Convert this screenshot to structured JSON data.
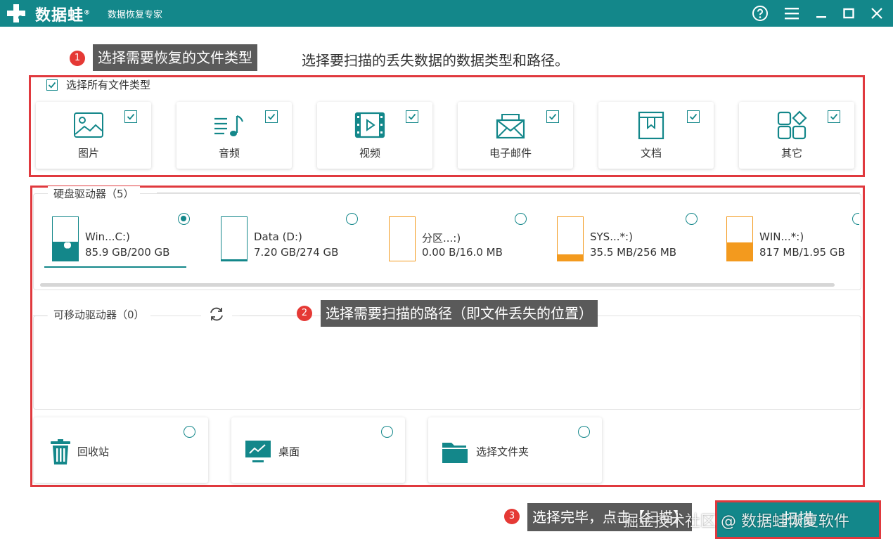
{
  "titlebar": {
    "brand": "数据蛙",
    "trademark": "®",
    "subtitle": "数据恢复专家"
  },
  "annotations": {
    "step1_badge": "1",
    "step1_text": "选择需要恢复的文件类型",
    "step2_badge": "2",
    "step2_text": "选择需要扫描的路径（即文件丢失的位置）",
    "step3_badge": "3",
    "step3_text": "选择完毕，点击【扫描】"
  },
  "subtitle": "选择要扫描的丢失数据的数据类型和路径。",
  "file_types": {
    "select_all_label": "选择所有文件类型",
    "select_all_checked": true,
    "items": [
      {
        "label": "图片",
        "icon": "image-icon",
        "checked": true
      },
      {
        "label": "音频",
        "icon": "music-icon",
        "checked": true
      },
      {
        "label": "视频",
        "icon": "video-icon",
        "checked": true
      },
      {
        "label": "电子邮件",
        "icon": "mail-icon",
        "checked": true
      },
      {
        "label": "文档",
        "icon": "document-icon",
        "checked": true
      },
      {
        "label": "其它",
        "icon": "other-icon",
        "checked": true
      }
    ]
  },
  "hard_drives": {
    "label": "硬盘驱动器（5）",
    "items": [
      {
        "name": "Win...C:)",
        "size": "85.9 GB/200 GB",
        "used_fraction": 0.43,
        "fill_color": "#13878a",
        "selected": true,
        "icon": "windows-logo-icon"
      },
      {
        "name": "Data (D:)",
        "size": "7.20 GB/274 GB",
        "used_fraction": 0.03,
        "fill_color": "#13878a",
        "selected": false
      },
      {
        "name": "分区...:)",
        "size": "0.00  B/16.0 MB",
        "used_fraction": 0.0,
        "fill_color": "#f39a1e",
        "selected": false
      },
      {
        "name": "SYS...*:)",
        "size": "35.5 MB/256 MB",
        "used_fraction": 0.14,
        "fill_color": "#f39a1e",
        "selected": false
      },
      {
        "name": "WIN...*:)",
        "size": "817 MB/1.95 GB",
        "used_fraction": 0.42,
        "fill_color": "#f39a1e",
        "selected": false
      }
    ]
  },
  "removable": {
    "label": "可移动驱动器（0）"
  },
  "locations": [
    {
      "label": "回收站",
      "icon": "recycle-bin-icon",
      "selected": false
    },
    {
      "label": "桌面",
      "icon": "desktop-icon",
      "selected": false
    },
    {
      "label": "选择文件夹",
      "icon": "folder-icon",
      "selected": false
    }
  ],
  "scan_button": {
    "label": "扫描"
  },
  "watermark": "掘金技术社区 @ 数据蛙恢复软件",
  "colors": {
    "accent": "#13878a",
    "annotation_red": "#e0393e",
    "callout_bg": "#5a5a5a",
    "partition_orange": "#f39a1e"
  }
}
